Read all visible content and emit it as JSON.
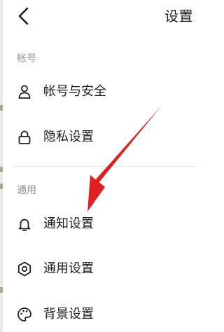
{
  "header": {
    "title": "设置",
    "back_icon": "chevron-left-icon"
  },
  "sections": [
    {
      "label": "帐号",
      "items": [
        {
          "label": "帐号与安全",
          "icon": "person-icon"
        },
        {
          "label": "隐私设置",
          "icon": "lock-icon"
        }
      ]
    },
    {
      "label": "通用",
      "items": [
        {
          "label": "通知设置",
          "icon": "bell-icon"
        },
        {
          "label": "通用设置",
          "icon": "gear-icon"
        },
        {
          "label": "背景设置",
          "icon": "palette-icon"
        }
      ]
    }
  ],
  "annotation": {
    "type": "red-arrow",
    "color": "#e02020",
    "points_to": "通知设置"
  }
}
